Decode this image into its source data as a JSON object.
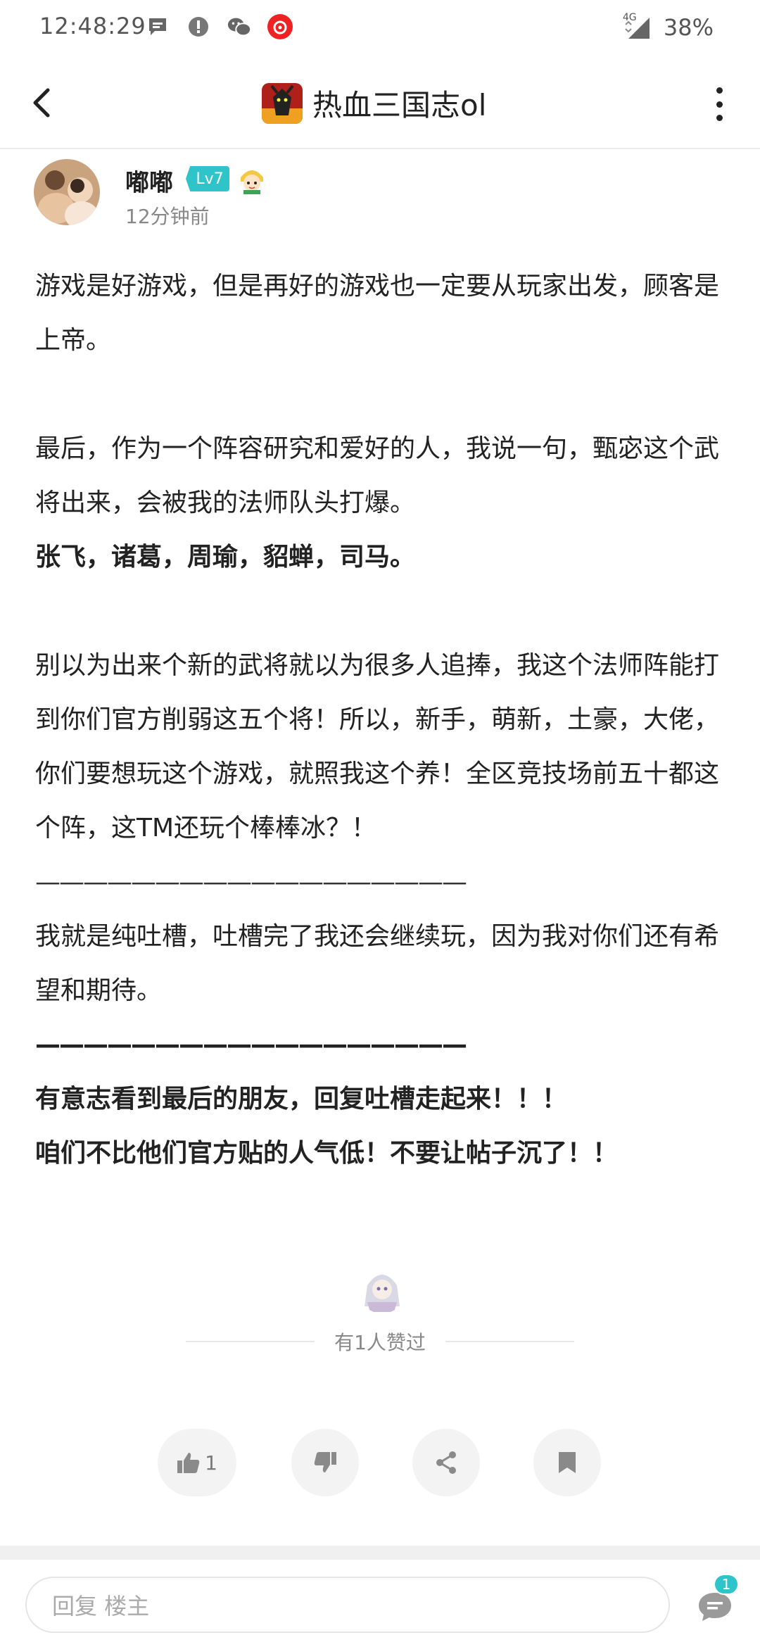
{
  "status_bar": {
    "time": "12:48:29",
    "network": "4G",
    "battery": "38%"
  },
  "header": {
    "title": "热血三国志ol"
  },
  "author": {
    "name": "嘟嘟",
    "level": "Lv7",
    "time_ago": "12分钟前"
  },
  "post": {
    "paragraphs": [
      "游戏是好游戏，但是再好的游戏也一定要从玩家出发，顾客是上帝。",
      "最后，作为一个阵容研究和爱好的人，我说一句，甄宓这个武将出来，会被我的法师队头打爆。",
      "张飞，诸葛，周瑜，貂蝉，司马。",
      "别以为出来个新的武将就以为很多人追捧，我这个法师阵能打到你们官方削弱这五个将！所以，新手，萌新，土豪，大佬，你们要想玩这个游戏，就照我这个养！全区竞技场前五十都这个阵，这TM还玩个棒棒冰？！",
      "——————————————————",
      "我就是纯吐槽，吐槽完了我还会继续玩，因为我对你们还有希望和期待。",
      "——————————————————",
      "有意志看到最后的朋友，回复吐槽走起来！！！",
      "咱们不比他们官方贴的人气低！不要让帖子沉了！！"
    ]
  },
  "likes": {
    "summary": "有1人赞过"
  },
  "actions": {
    "like_count": "1"
  },
  "reply": {
    "placeholder": "回复  楼主",
    "comment_badge": "1"
  },
  "colors": {
    "accent": "#2ec4c9",
    "text": "#222222",
    "muted": "#888888"
  }
}
